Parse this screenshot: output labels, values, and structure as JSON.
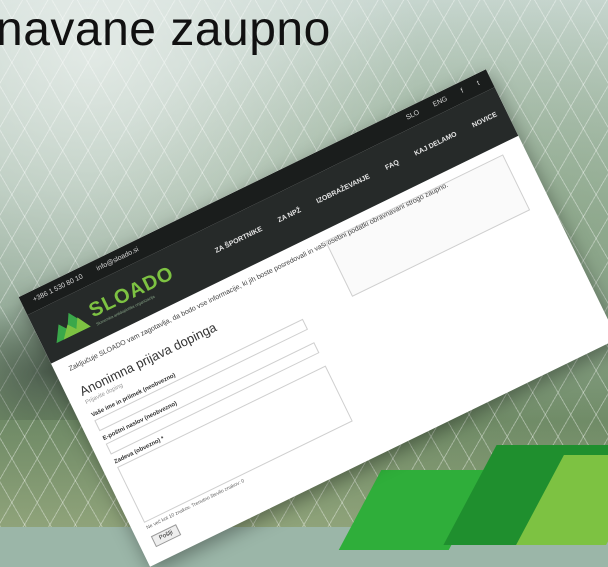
{
  "headline": "navane zaupno",
  "topbar": {
    "phone": "+386 1 530 80 10",
    "email": "info@sloado.si",
    "lang_sl": "SLO",
    "lang_en": "ENG",
    "social_fb": "f",
    "social_tw": "t"
  },
  "logo": {
    "text": "SLOADO",
    "tagline": "Slovenska antidopinška organizacija"
  },
  "nav": {
    "items": [
      "ZA ŠPORTNIKE",
      "ZA NPŽ",
      "IZOBRAŽEVANJE",
      "FAQ",
      "KAJ DELAMO",
      "NOVICE"
    ]
  },
  "content": {
    "intro": "Zaključuje SLOADO vam zagotavlja, da bodo vse informacije, ki jih boste posredovali in vaši osebni podatki obravnavani strogo zaupno.",
    "form_title": "Anonimna prijava dopinga",
    "form_sub": "Prijavite doping",
    "name_label": "Vaše ime in priimek (neobvezno)",
    "email_label": "E-poštni naslov (neobvezno)",
    "message_label": "Zadeva (obvezno) *",
    "counter": "Ne več kot 10 znakov. Trenutno število znakov: 0",
    "submit": "Pošlji"
  }
}
